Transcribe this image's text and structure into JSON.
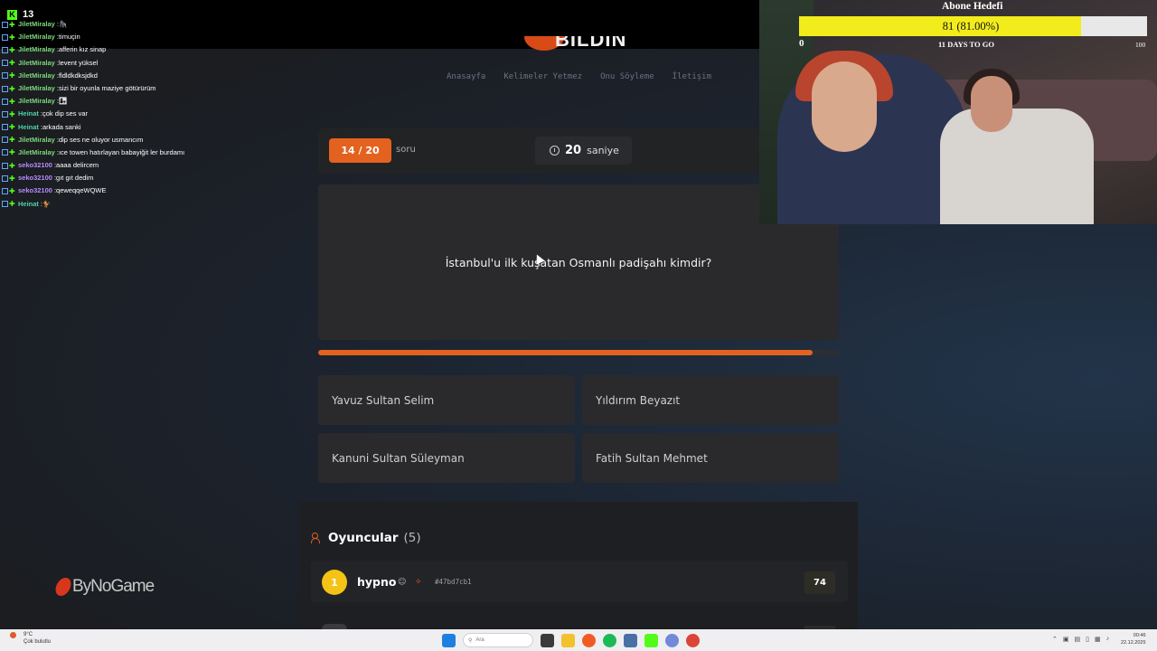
{
  "stream": {
    "kick_viewers": "13",
    "chat": [
      {
        "user": "JiletMiralay",
        "color": "#7dd87d",
        "msg": "🦍"
      },
      {
        "user": "JiletMiralay",
        "color": "#7dd87d",
        "msg": "timuçin"
      },
      {
        "user": "JiletMiralay",
        "color": "#7dd87d",
        "msg": "afferin kız sinap"
      },
      {
        "user": "JiletMiralay",
        "color": "#7dd87d",
        "msg": "levent yüksel"
      },
      {
        "user": "JiletMiralay",
        "color": "#7dd87d",
        "msg": "fldldkdksjdkd"
      },
      {
        "user": "JiletMiralay",
        "color": "#7dd87d",
        "msg": "sizi bir oyunla maziye götürürüm"
      },
      {
        "user": "JiletMiralay",
        "color": "#7dd87d",
        "msg": "👩‍👧"
      },
      {
        "user": "Heinat",
        "color": "#4fd1a5",
        "msg": "çok dip ses var"
      },
      {
        "user": "Heinat",
        "color": "#4fd1a5",
        "msg": "arkada sanki"
      },
      {
        "user": "JiletMiralay",
        "color": "#7dd87d",
        "msg": "dip ses ne oluyor usmancım"
      },
      {
        "user": "JiletMiralay",
        "color": "#7dd87d",
        "msg": "ıce towen hatırlayan babayiğit ler burdamı"
      },
      {
        "user": "seko32100",
        "color": "#b58cff",
        "msg": "aaaa delircem"
      },
      {
        "user": "seko32100",
        "color": "#b58cff",
        "msg": "gıt gıt dedim"
      },
      {
        "user": "seko32100",
        "color": "#b58cff",
        "msg": "qeweqqeWQWE"
      },
      {
        "user": "Heinat",
        "color": "#4fd1a5",
        "msg": "🐓"
      }
    ],
    "watermark": "ByNoGame",
    "sub_goal": {
      "title": "Abone Hedefi",
      "current_label": "81 (81.00%)",
      "progress": 0.81,
      "min": "0",
      "max": "100",
      "days_left": "11 DAYS TO GO"
    }
  },
  "site": {
    "logo_text": "BİLDİN",
    "nav": [
      "Anasayfa",
      "Kelimeler Yetmez",
      "Onu Söyleme",
      "İletişim"
    ]
  },
  "quiz": {
    "counter": "14 / 20",
    "counter_suffix": "soru",
    "timer_value": "20",
    "timer_unit": "saniye",
    "question": "İstanbul'u ilk kuşatan Osmanlı padişahı kimdir?",
    "progress": 0.95,
    "accent": "#e4621f",
    "answers": [
      "Yavuz Sultan Selim",
      "Yıldırım Beyazıt",
      "Kanuni Sultan Süleyman",
      "Fatih Sultan Mehmet"
    ]
  },
  "players": {
    "title": "Oyuncular",
    "count": "(5)",
    "list": [
      {
        "rank": "1",
        "name": "hypno",
        "id": "#47bd7cb1",
        "score": "74"
      }
    ]
  },
  "taskbar": {
    "weather_temp": "9°C",
    "weather_desc": "Çok bulutlu",
    "search_placeholder": "Ara",
    "time": "00:46",
    "date": "22.12.2025"
  }
}
